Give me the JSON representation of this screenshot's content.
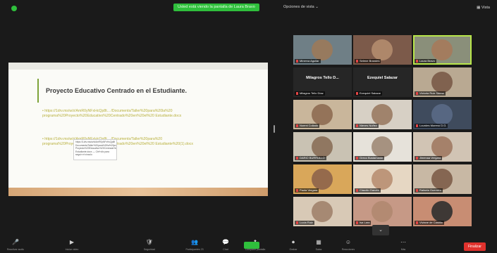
{
  "top_bar": {
    "share_banner": "Usted está viendo la pantalla de Laura Bravo",
    "view_options": "Opciones de vista ⌄",
    "view_button": "▦ Vista",
    "colors": {
      "background": "#1a1a1a",
      "banner": "#2fbf3c"
    }
  },
  "slide": {
    "title": "Proyecto Educativo Centrado en el Estudiante.",
    "links": [
      "• https://1drv.ms/w/s!AmR0yNFxHcQp8t... /Documents/Taller%20para%20la%20 programa%20Proyecto%20Educativo%20Centrado%20en%20el%20 Estudiante.docx",
      "• https://1drv.ms/w/s!AmR0yNFxHcQp8t... /Documents/Taller%20para%20 programa%20Proyecto%20Educativo%20Centrado%20en%20el%20 Estudiante%20(1).docx"
    ],
    "tooltip": "https://1drv.ms/w/s!AmR0yNFxHcQp8t Documents/Taller%20para%20la%20programa Proyecto%20Educativo%20Centrado%20en Estudiante.docx — Ctrl+clic para seguir el vínculo"
  },
  "participants": [
    {
      "name": "Minerva Aguilar",
      "face": "#9b7a5a",
      "bg": "#6f7f86"
    },
    {
      "name": "Selene Brandes",
      "face": "#b48c6e",
      "bg": "#7c5a4a"
    },
    {
      "name": "Laura Bravo",
      "face": "#a57a5b",
      "bg": "#8a8f7a",
      "active": true
    },
    {
      "name": "Milagros Tello Díaz",
      "big_name": "Milagros Tello D...",
      "name_only": true
    },
    {
      "name": "Ezequiel Salazar",
      "big_name": "Ezequiel Salazar",
      "name_only": true
    },
    {
      "name": "Victoria Ruiz Sáenz",
      "face": "#7a5a48",
      "bg": "#b9a992"
    },
    {
      "name": "Noemi Collado",
      "face": "#8e6b52",
      "bg": "#c9b69b"
    },
    {
      "name": "Nieves Núñez",
      "face": "#9a7a62",
      "bg": "#d7d0c5"
    },
    {
      "name": "Lourdes Moreno D.G.",
      "face": "#5a6a86",
      "bg": "#3f4b5d"
    },
    {
      "name": "DARIO BURRULLO",
      "face": "#8a6f58",
      "bg": "#c9c2b3"
    },
    {
      "name": "Greco Bustamante",
      "face": "#9f8a76",
      "bg": "#e6e2da"
    },
    {
      "name": "Jimenaa Vergara",
      "face": "#a07a62",
      "bg": "#d1c4b4"
    },
    {
      "name": "Paola Vergara",
      "face": "#8d644a",
      "bg": "#d9a75a"
    },
    {
      "name": "Claudio Garcés",
      "face": "#b88f72",
      "bg": "#e6d7c3"
    },
    {
      "name": "Rafaela Guerrero",
      "face": "#7d5d49",
      "bg": "#c8b8a4"
    },
    {
      "name": "Lucía Ruiz",
      "face": "#a1826b",
      "bg": "#d8c9b6"
    },
    {
      "name": "Isa Lara",
      "face": "#b08870",
      "bg": "#c69986"
    },
    {
      "name": "Viviane de Castillo",
      "face": "#2f2f2f",
      "bg": "#c88d73"
    }
  ],
  "toolbar": {
    "items": [
      {
        "icon": "🎤",
        "label": "Reactivar audio",
        "name": "unmute-button"
      },
      {
        "icon": "▶",
        "label": "Iniciar video",
        "name": "video-button"
      },
      {
        "icon": "🛡",
        "label": "Seguridad",
        "name": "security-button"
      },
      {
        "icon": "👥",
        "label": "Participantes 23",
        "name": "participants-button"
      },
      {
        "icon": "💬",
        "label": "Chat",
        "name": "chat-button"
      },
      {
        "icon": "⬆",
        "label": "Compartir pantalla",
        "name": "share-screen-button"
      },
      {
        "icon": "⏺",
        "label": "Grabar",
        "name": "record-button"
      },
      {
        "icon": "▦",
        "label": "Salas",
        "name": "rooms-button"
      },
      {
        "icon": "☺",
        "label": "Reacciones",
        "name": "reactions-button"
      },
      {
        "icon": "⋯",
        "label": "Más",
        "name": "more-button"
      }
    ],
    "end_label": "Finalizar",
    "colors": {
      "share": "#2fbf3c",
      "end": "#e0322d"
    }
  },
  "collapse_icon": "⌄"
}
